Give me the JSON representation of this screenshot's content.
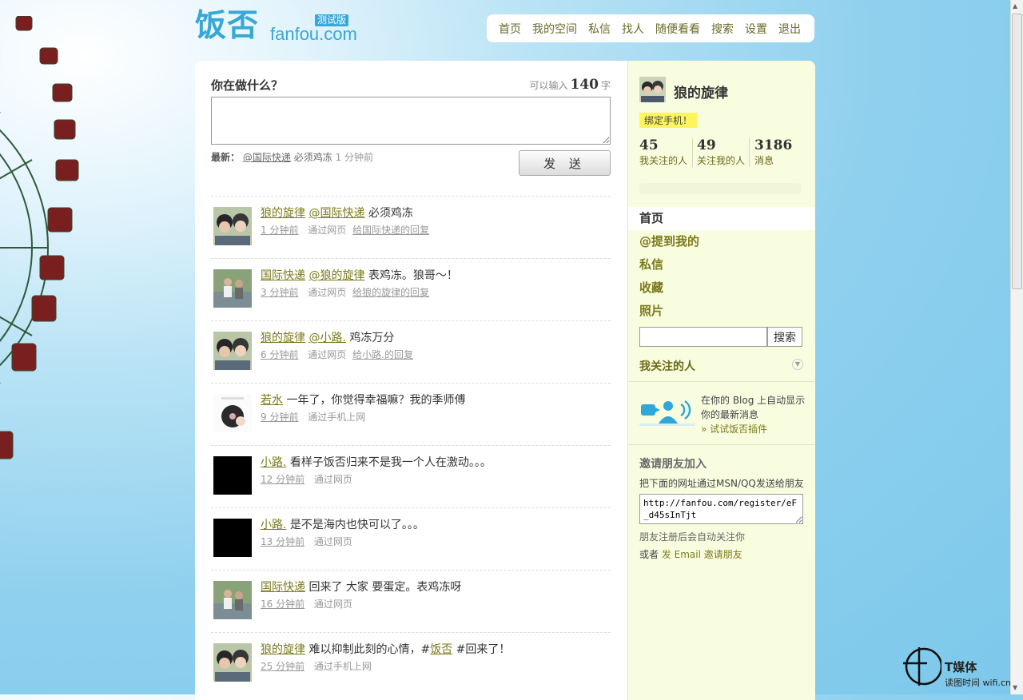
{
  "header": {
    "logo_zh": "饭否",
    "logo_en": "fanfou.com",
    "logo_badge": "测试版",
    "nav": [
      "首页",
      "我的空间",
      "私信",
      "找人",
      "随便看看",
      "搜索",
      "设置",
      "退出"
    ]
  },
  "composer": {
    "prompt": "你在做什么？",
    "counter_prefix": "可以输入",
    "counter_value": "140",
    "counter_suffix": "字",
    "latest_label": "最新：",
    "latest_mention": "@国际快递",
    "latest_text": "必须鸡冻",
    "latest_time": "1 分钟前",
    "send_label": "发 送"
  },
  "timeline": [
    {
      "author": "狼的旋律",
      "prefix": "",
      "mention": "@国际快递",
      "text": "必须鸡冻",
      "time": "1 分钟前",
      "via": "通过网页",
      "reply": "给国际快递的回复",
      "avatar": "photo-pair"
    },
    {
      "author": "国际快递",
      "prefix": "",
      "mention": "@狼的旋律",
      "text": "表鸡冻。狼哥～！",
      "time": "3 分钟前",
      "via": "通过网页",
      "reply": "给狼的旋律的回复",
      "avatar": "photo-outdoor"
    },
    {
      "author": "狼的旋律",
      "prefix": "",
      "mention": "@小路.",
      "text": "鸡冻万分",
      "time": "6 分钟前",
      "via": "通过网页",
      "reply": "给小路.的回复",
      "avatar": "photo-pair"
    },
    {
      "author": "若水",
      "prefix": "",
      "mention": "",
      "text": "一年了，你觉得幸福嘛？我的季师傅",
      "time": "9 分钟前",
      "via": "通过手机上网",
      "reply": "",
      "avatar": "photo-record"
    },
    {
      "author": "小路.",
      "prefix": "",
      "mention": "",
      "text": "看样子饭否归来不是我一个人在激动。。。",
      "time": "12 分钟前",
      "via": "通过网页",
      "reply": "",
      "avatar": "black"
    },
    {
      "author": "小路.",
      "prefix": "",
      "mention": "",
      "text": "是不是海内也快可以了。。。",
      "time": "13 分钟前",
      "via": "通过网页",
      "reply": "",
      "avatar": "black"
    },
    {
      "author": "国际快递",
      "prefix": "",
      "mention": "",
      "text": "回来了 大家 要蛋定。表鸡冻呀",
      "time": "16 分钟前",
      "via": "通过网页",
      "reply": "",
      "avatar": "photo-outdoor"
    },
    {
      "author": "狼的旋律",
      "prefix": "难以抑制此刻的心情，#",
      "mention": "饭否",
      "text": "#回来了！",
      "time": "25 分钟前",
      "via": "通过手机上网",
      "reply": "",
      "avatar": "photo-pair"
    }
  ],
  "sidebar": {
    "username": "狼的旋律",
    "bind_phone": "绑定手机！",
    "stats": [
      {
        "value": "45",
        "label": "我关注的人"
      },
      {
        "value": "49",
        "label": "关注我的人"
      },
      {
        "value": "3186",
        "label": "消息"
      }
    ],
    "menu": [
      "首页",
      "@提到我的",
      "私信",
      "收藏",
      "照片"
    ],
    "search_button": "搜索",
    "following_title": "我关注的人",
    "plugin_line1": "在你的 Blog 上自动显示",
    "plugin_line2": "你的最新消息",
    "plugin_link": "» 试试饭否插件",
    "invite_title": "邀请朋友加入",
    "invite_desc": "把下面的网址通过MSN/QQ发送给朋友",
    "invite_url": "http://fanfou.com/register/eF_d45sInTjt",
    "invite_note": "朋友注册后会自动关注你",
    "invite_email_prefix": "或者",
    "invite_email_link": "发 Email 邀请朋友"
  },
  "watermark": {
    "name": "T媒体",
    "sub": "读图时间 wifi.cn"
  },
  "colors": {
    "brand": "#37a7d6",
    "link": "#7a7a1a",
    "sidebar_bg": "#f9fde0"
  }
}
